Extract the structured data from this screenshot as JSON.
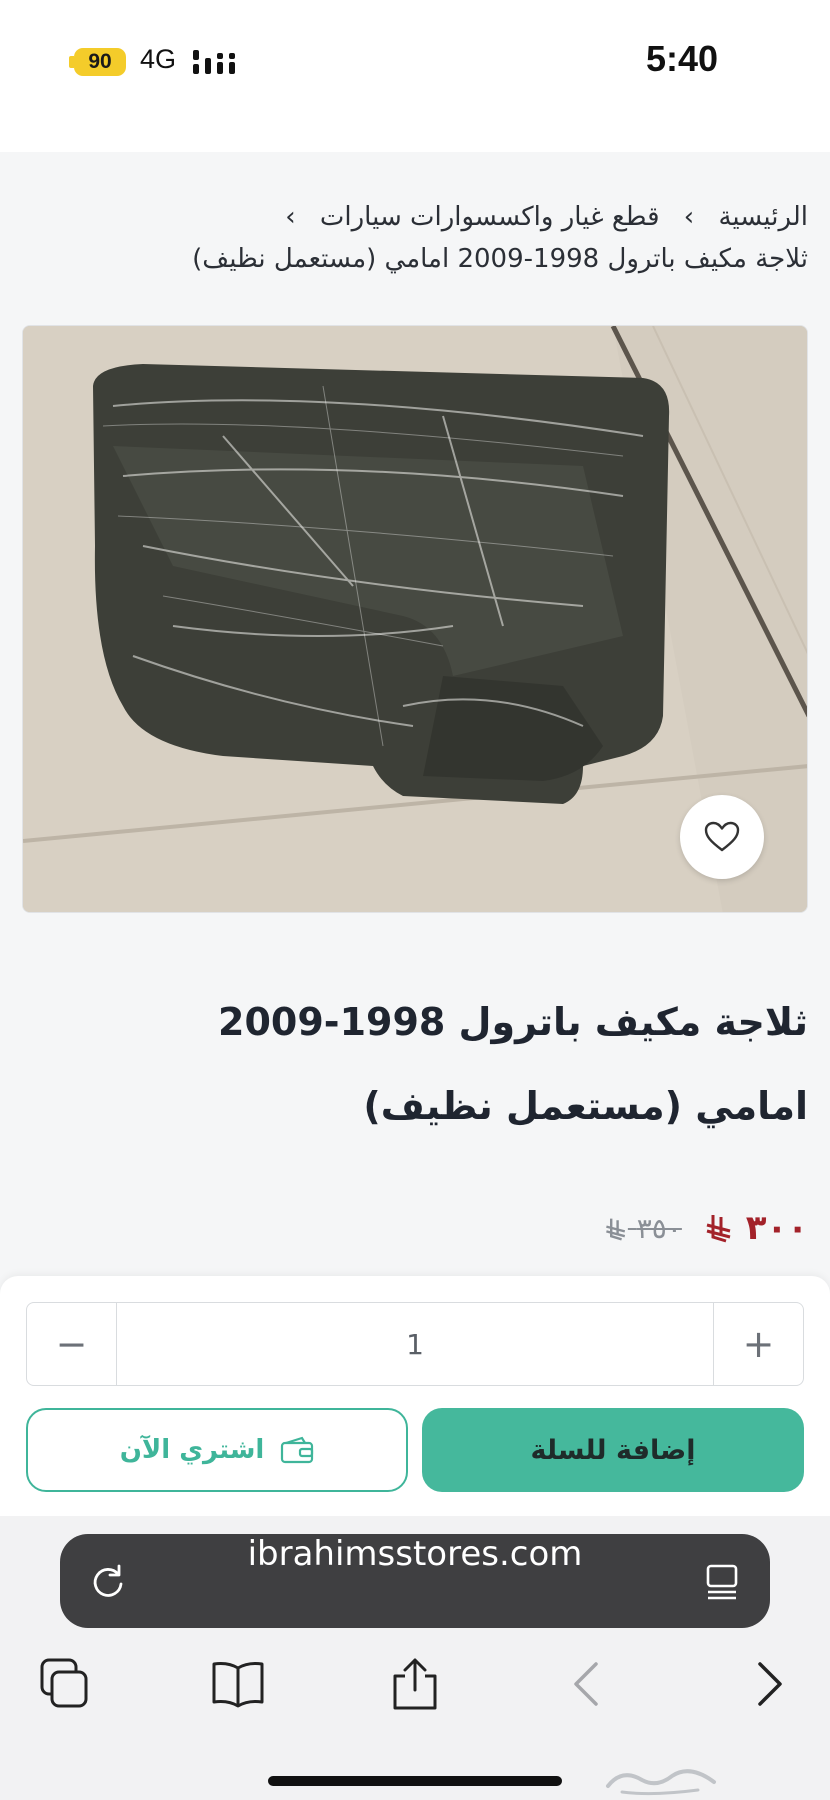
{
  "status_bar": {
    "battery": "90",
    "network": "4G",
    "time": "5:40"
  },
  "breadcrumb": {
    "home": "الرئيسية",
    "category": "قطع غيار واكسسوارات سيارات",
    "separator": "›",
    "current": "ثلاجة مكيف باترول 1998-2009 امامي (مستعمل نظيف)"
  },
  "product": {
    "image_icon": "product-photo",
    "favorite_icon": "heart-icon",
    "title": "ثلاجة مكيف باترول 1998-2009 امامي (مستعمل نظيف)",
    "price_current": "٣٠٠",
    "price_old": "٣٥٠",
    "currency_icon": "riyal-symbol",
    "price_color": "#a3222a"
  },
  "purchase": {
    "quantity": "1",
    "minus_label": "−",
    "plus_label": "+",
    "buy_now_label": "اشتري الآن",
    "add_to_cart_label": "إضافة للسلة",
    "accent_color": "#45b89c"
  },
  "browser": {
    "url": "ibrahimsstores.com",
    "icons": [
      "reload-icon",
      "reader-icon",
      "tabs-icon",
      "bookmarks-icon",
      "share-icon",
      "back-icon",
      "forward-icon"
    ]
  }
}
